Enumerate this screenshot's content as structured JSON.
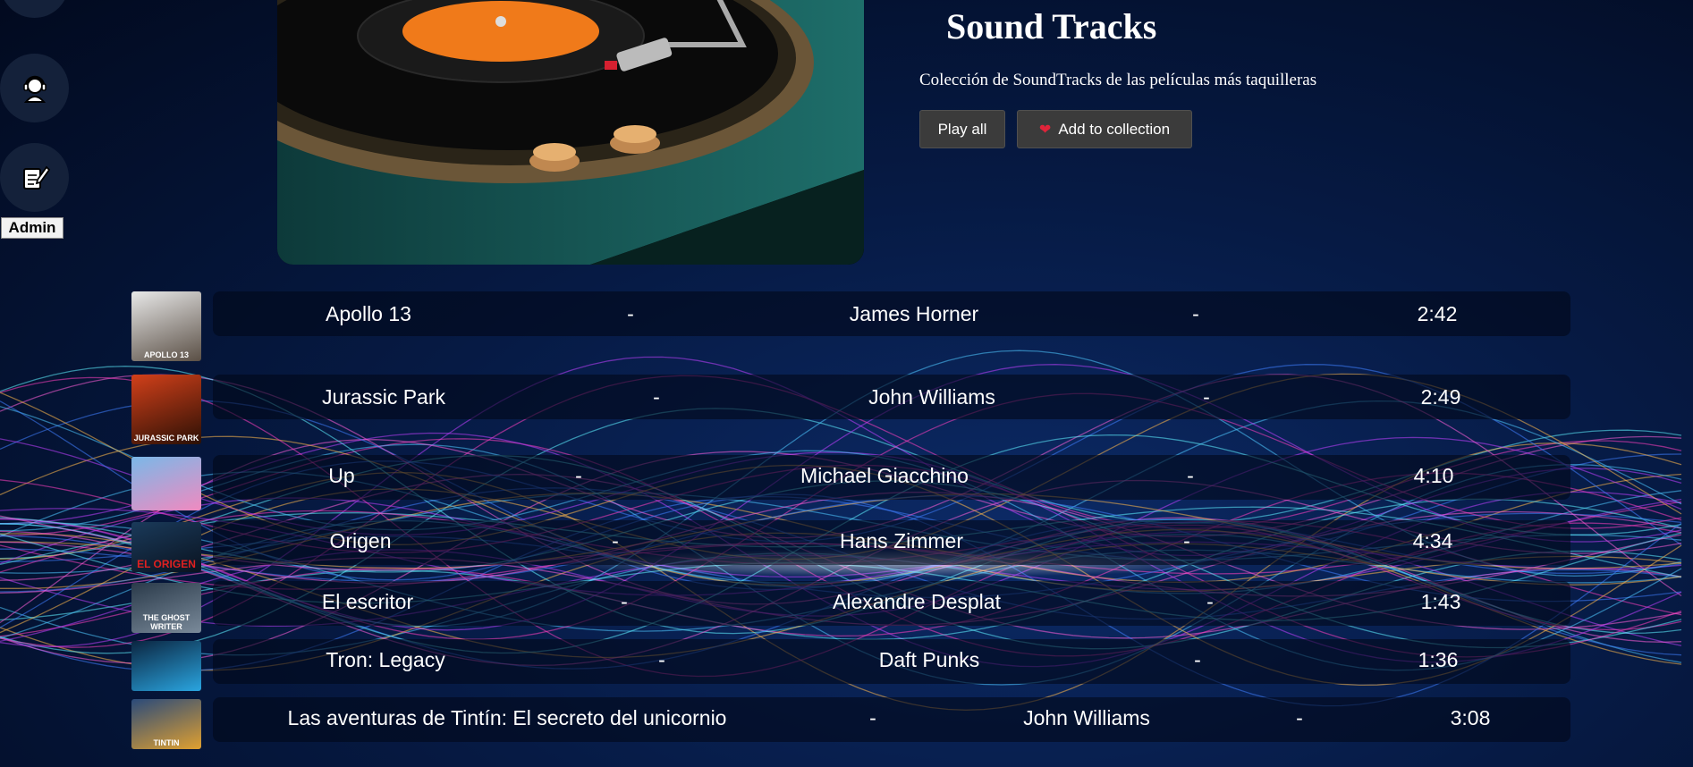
{
  "sidebar": {
    "items": [
      {
        "icon": "headset-user-icon"
      },
      {
        "icon": "edit-document-icon"
      }
    ],
    "admin_label": "Admin"
  },
  "playlist": {
    "title": "Sound Tracks",
    "description": "Colección de SoundTracks de las películas más taquilleras",
    "play_all_label": "Play all",
    "add_label": "Add to collection",
    "add_icon": "heart-icon"
  },
  "tracks": [
    {
      "title": "Apollo 13",
      "sep1": "-",
      "artist": "James Horner",
      "sep2": "-",
      "duration": "2:42"
    },
    {
      "title": "Jurassic Park",
      "sep1": "-",
      "artist": "John Williams",
      "sep2": "-",
      "duration": "2:49"
    },
    {
      "title": "Up",
      "sep1": "-",
      "artist": "Michael Giacchino",
      "sep2": "-",
      "duration": "4:10"
    },
    {
      "title": "Origen",
      "sep1": "-",
      "artist": "Hans Zimmer",
      "sep2": "-",
      "duration": "4:34"
    },
    {
      "title": "El escritor",
      "sep1": "-",
      "artist": "Alexandre Desplat",
      "sep2": "-",
      "duration": "1:43"
    },
    {
      "title": "Tron: Legacy",
      "sep1": "-",
      "artist": "Daft Punks",
      "sep2": "-",
      "duration": "1:36"
    },
    {
      "title": "Las aventuras de Tintín: El secreto del unicornio",
      "sep1": "-",
      "artist": "John Williams",
      "sep2": "-",
      "duration": "3:08"
    }
  ],
  "thumbnails": [
    {
      "caption": "APOLLO 13"
    },
    {
      "caption": "JURASSIC PARK"
    },
    {
      "caption": ""
    },
    {
      "caption": "EL ORIGEN"
    },
    {
      "caption": "THE GHOST WRITER"
    },
    {
      "caption": ""
    },
    {
      "caption": "TINTIN"
    }
  ],
  "colors": {
    "background": "#061a44",
    "row": "#02081a",
    "button": "#3b3b3b",
    "heart": "#e0243a"
  }
}
